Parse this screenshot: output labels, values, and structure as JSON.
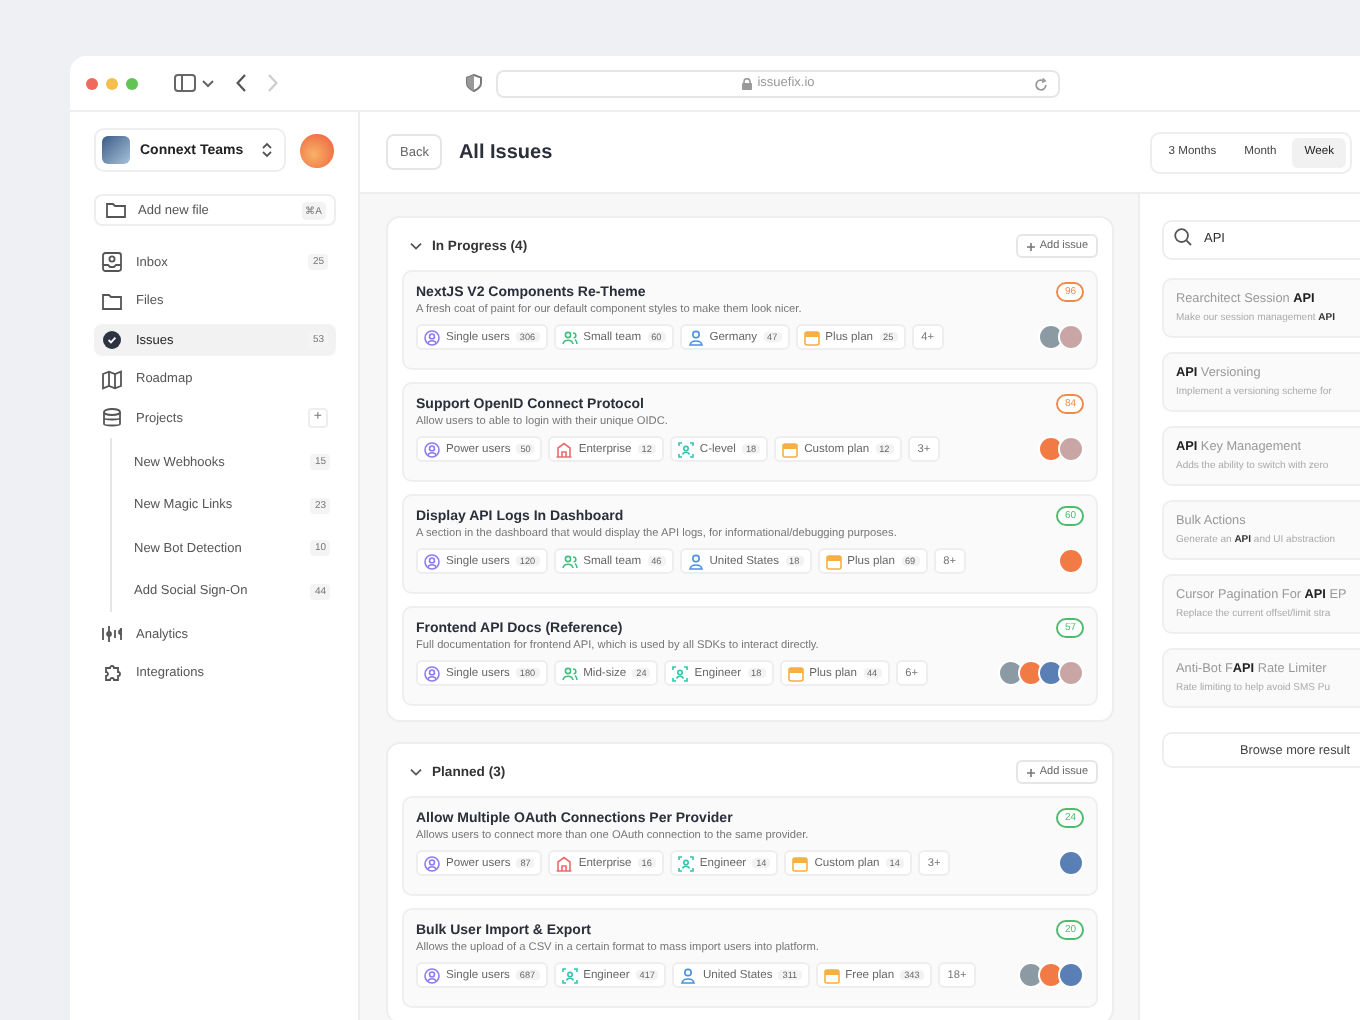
{
  "browser": {
    "url": "issuefix.io"
  },
  "sidebar": {
    "team": "Connext Teams",
    "add_file": {
      "label": "Add new file",
      "shortcut": "⌘A"
    },
    "items": [
      {
        "kind": "inbox",
        "label": "Inbox",
        "count": "25",
        "selected": false
      },
      {
        "kind": "folder",
        "label": "Files",
        "selected": false
      },
      {
        "kind": "issues",
        "label": "Issues",
        "count": "53",
        "selected": true
      },
      {
        "kind": "roadmap",
        "label": "Roadmap",
        "selected": false
      },
      {
        "kind": "projects",
        "label": "Projects",
        "add": "+",
        "selected": false,
        "children": [
          {
            "label": "New Webhooks",
            "count": "15",
            "selected": false
          },
          {
            "label": "New Magic Links",
            "count": "23",
            "selected": false
          },
          {
            "label": "New Bot Detection",
            "count": "10",
            "selected": false
          },
          {
            "label": "Add Social Sign-On",
            "count": "44",
            "selected": false
          }
        ]
      },
      {
        "kind": "analytics",
        "label": "Analytics",
        "selected": false
      },
      {
        "kind": "integrations",
        "label": "Integrations",
        "selected": false
      }
    ]
  },
  "header": {
    "back": "Back",
    "title": "All Issues",
    "ranges": [
      {
        "label": "3 Months",
        "selected": false
      },
      {
        "label": "Month",
        "selected": false
      },
      {
        "label": "Week",
        "selected": true
      }
    ]
  },
  "groups": [
    {
      "title": "In Progress (4)",
      "expanded": true,
      "add": "Add issue",
      "issues": [
        {
          "title": "NextJS V2 Components Re-Theme",
          "description": "A fresh coat of paint for our default component styles to make them look nicer.",
          "score": "96",
          "color": "#f08a4b",
          "tags": [
            {
              "kind": "users",
              "label": "Single users",
              "count": "306",
              "color": "#8b7cf6"
            },
            {
              "kind": "team",
              "label": "Small team",
              "count": "60",
              "color": "#3fbf7f"
            },
            {
              "kind": "region",
              "label": "Germany",
              "count": "47",
              "color": "#4a90e2"
            },
            {
              "kind": "plan",
              "label": "Plus plan",
              "count": "25",
              "color": "#f5b041"
            }
          ],
          "more": "4+",
          "avatars": [
            {
              "color": "#8c9aa3"
            },
            {
              "color": "#c9a5a5"
            }
          ]
        },
        {
          "title": "Support OpenID Connect Protocol",
          "description": "Allow users to able to login with their unique OIDC.",
          "score": "84",
          "color": "#f08a4b",
          "tags": [
            {
              "kind": "users",
              "label": "Power users",
              "count": "50",
              "color": "#8b7cf6"
            },
            {
              "kind": "company",
              "label": "Enterprise",
              "count": "12",
              "color": "#ec6b6b"
            },
            {
              "kind": "role",
              "label": "C-level",
              "count": "18",
              "color": "#34c3b0"
            },
            {
              "kind": "plan",
              "label": "Custom plan",
              "count": "12",
              "color": "#f5b041"
            }
          ],
          "more": "3+",
          "avatars": [
            {
              "color": "#f27b45"
            },
            {
              "color": "#c9a5a5"
            }
          ]
        },
        {
          "title": "Display API Logs In Dashboard",
          "description": "A section in the dashboard that would display the API logs, for informational/debugging purposes.",
          "score": "60",
          "color": "#4cbb6c",
          "tags": [
            {
              "kind": "users",
              "label": "Single users",
              "count": "120",
              "color": "#8b7cf6"
            },
            {
              "kind": "team",
              "label": "Small team",
              "count": "46",
              "color": "#3fbf7f"
            },
            {
              "kind": "region",
              "label": "United States",
              "count": "18",
              "color": "#4a90e2"
            },
            {
              "kind": "plan",
              "label": "Plus plan",
              "count": "69",
              "color": "#f5b041"
            }
          ],
          "more": "8+",
          "avatars": [
            {
              "color": "#f27b45"
            }
          ]
        },
        {
          "title": "Frontend API Docs (Reference)",
          "description": "Full documentation for frontend API, which is used by all SDKs to interact directly.",
          "score": "57",
          "color": "#4cbb6c",
          "tags": [
            {
              "kind": "users",
              "label": "Single users",
              "count": "180",
              "color": "#8b7cf6"
            },
            {
              "kind": "team",
              "label": "Mid-size",
              "count": "24",
              "color": "#3fbf7f"
            },
            {
              "kind": "role",
              "label": "Engineer",
              "count": "18",
              "color": "#34c3b0"
            },
            {
              "kind": "plan",
              "label": "Plus plan",
              "count": "44",
              "color": "#f5b041"
            }
          ],
          "more": "6+",
          "avatars": [
            {
              "color": "#8c9aa3"
            },
            {
              "color": "#f27b45"
            },
            {
              "color": "#5a7fb5"
            },
            {
              "color": "#c9a5a5"
            }
          ]
        }
      ]
    },
    {
      "title": "Planned (3)",
      "expanded": true,
      "add": "Add issue",
      "issues": [
        {
          "title": "Allow Multiple OAuth Connections Per Provider",
          "description": "Allows users to connect more than one OAuth connection to the same provider.",
          "score": "24",
          "color": "#4cbb6c",
          "tags": [
            {
              "kind": "users",
              "label": "Power users",
              "count": "87",
              "color": "#8b7cf6"
            },
            {
              "kind": "company",
              "label": "Enterprise",
              "count": "16",
              "color": "#ec6b6b"
            },
            {
              "kind": "role",
              "label": "Engineer",
              "count": "14",
              "color": "#34c3b0"
            },
            {
              "kind": "plan",
              "label": "Custom plan",
              "count": "14",
              "color": "#f5b041"
            }
          ],
          "more": "3+",
          "avatars": [
            {
              "color": "#5a7fb5"
            }
          ]
        },
        {
          "title": "Bulk User Import & Export",
          "description": "Allows the upload of a CSV in a certain format to mass import users into platform.",
          "score": "20",
          "color": "#4cbb6c",
          "tags": [
            {
              "kind": "users",
              "label": "Single users",
              "count": "687",
              "color": "#8b7cf6"
            },
            {
              "kind": "role",
              "label": "Engineer",
              "count": "417",
              "color": "#34c3b0"
            },
            {
              "kind": "region",
              "label": "United States",
              "count": "311",
              "color": "#4a90e2"
            },
            {
              "kind": "plan",
              "label": "Free plan",
              "count": "343",
              "color": "#f5b041"
            }
          ],
          "more": "18+",
          "avatars": [
            {
              "color": "#8c9aa3"
            },
            {
              "color": "#f27b45"
            },
            {
              "color": "#5a7fb5"
            }
          ]
        }
      ]
    }
  ],
  "search": {
    "value": "API",
    "results": [
      {
        "title": "Rearchitect Session **API**",
        "description": "Make our session management **API**"
      },
      {
        "title": "**API** Versioning",
        "description": "Implement a versioning scheme for"
      },
      {
        "title": "**API** Key Management",
        "description": "Adds the ability to switch with zero"
      },
      {
        "title": "Bulk Actions",
        "description": "Generate an **API** and UI abstraction"
      },
      {
        "title": "Cursor Pagination For **API** EP",
        "description": "Replace the current offset/limit stra"
      },
      {
        "title": "Anti-Bot F**API** Rate Limiter",
        "description": "Rate limiting to help avoid SMS Pu"
      }
    ],
    "more": "Browse more result"
  }
}
